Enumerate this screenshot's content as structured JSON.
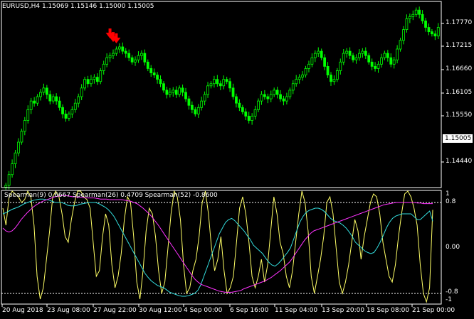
{
  "symbol_header": "EURUSD,H4  1.15069 1.15146 1.15000 1.15005",
  "indicator_header": "Spearman(9) 0.6667  Spearman(26) 0.4709  Spearman(52) -0.8600",
  "current_price": "1.15005",
  "price_axis": [
    "1.17770",
    "1.17215",
    "1.16660",
    "1.16105",
    "1.15550",
    "1.14440"
  ],
  "indicator_axis": [
    "1",
    "0.8",
    "0.00",
    "-0.8",
    "-1"
  ],
  "time_axis": [
    "20 Aug 2018",
    "23 Aug 08:00",
    "27 Aug 22:00",
    "30 Aug 12:00",
    "4 Sep 00:00",
    "6 Sep 16:00",
    "11 Sep 04:00",
    "13 Sep 20:00",
    "18 Sep 08:00",
    "21 Sep 00:00"
  ],
  "colors": {
    "background": "#000000",
    "candles": "#00ff00",
    "arrows": "#ff0000",
    "spearman9": "#ffff66",
    "spearman26": "#33dddd",
    "spearman52": "#ff33ff"
  },
  "chart_data": {
    "type": "candlestick",
    "price_ylim": [
      1.139,
      1.182
    ],
    "price_closes": [
      1.1395,
      1.142,
      1.1445,
      1.147,
      1.1495,
      1.152,
      1.1545,
      1.157,
      1.159,
      1.1585,
      1.16,
      1.161,
      1.162,
      1.1605,
      1.159,
      1.16,
      1.159,
      1.1575,
      1.156,
      1.155,
      1.156,
      1.157,
      1.1585,
      1.16,
      1.162,
      1.164,
      1.163,
      1.164,
      1.1645,
      1.1635,
      1.166,
      1.1675,
      1.169,
      1.1695,
      1.17,
      1.171,
      1.1715,
      1.1705,
      1.17,
      1.169,
      1.168,
      1.1685,
      1.1695,
      1.17,
      1.168,
      1.1665,
      1.1655,
      1.165,
      1.164,
      1.163,
      1.1615,
      1.1605,
      1.161,
      1.1615,
      1.1605,
      1.162,
      1.161,
      1.1595,
      1.158,
      1.157,
      1.156,
      1.1575,
      1.159,
      1.1605,
      1.1625,
      1.163,
      1.164,
      1.163,
      1.1625,
      1.164,
      1.1635,
      1.162,
      1.16,
      1.1585,
      1.1575,
      1.1565,
      1.1555,
      1.1545,
      1.1555,
      1.157,
      1.159,
      1.1605,
      1.16,
      1.1595,
      1.1605,
      1.1615,
      1.1605,
      1.1595,
      1.159,
      1.16,
      1.1615,
      1.163,
      1.164,
      1.1645,
      1.165,
      1.1665,
      1.1675,
      1.169,
      1.17,
      1.1705,
      1.169,
      1.167,
      1.165,
      1.1635,
      1.164,
      1.166,
      1.168,
      1.17,
      1.1705,
      1.1695,
      1.1685,
      1.169,
      1.17,
      1.1705,
      1.1695,
      1.168,
      1.167,
      1.1665,
      1.1675,
      1.169,
      1.17,
      1.169,
      1.1675,
      1.1685,
      1.171,
      1.173,
      1.1755,
      1.178,
      1.1785,
      1.179,
      1.18,
      1.179,
      1.1775,
      1.176,
      1.175,
      1.1745,
      1.174,
      1.176
    ],
    "arrow_index_range": [
      33,
      35
    ],
    "series": [
      {
        "name": "Spearman(9)",
        "values": [
          0.7,
          0.4,
          0.9,
          1.0,
          0.95,
          0.9,
          0.8,
          0.85,
          1.0,
          0.9,
          0.4,
          -0.5,
          -0.9,
          -0.7,
          -0.2,
          0.3,
          0.9,
          1.0,
          0.9,
          0.6,
          0.2,
          0.1,
          0.5,
          0.8,
          1.0,
          1.0,
          0.9,
          0.85,
          0.7,
          0.1,
          -0.5,
          -0.4,
          0.2,
          0.6,
          0.4,
          -0.3,
          -0.7,
          -0.5,
          -0.1,
          0.5,
          0.9,
          0.8,
          0.2,
          -0.6,
          -0.9,
          -0.4,
          0.3,
          0.7,
          0.6,
          0.2,
          -0.4,
          -0.8,
          -0.6,
          0.0,
          0.6,
          1.0,
          0.9,
          0.5,
          -0.3,
          -0.8,
          -0.7,
          -0.4,
          -0.2,
          0.2,
          0.8,
          1.0,
          0.6,
          0.0,
          -0.4,
          -0.2,
          0.2,
          -0.4,
          -0.8,
          -0.7,
          -0.5,
          0.1,
          0.7,
          0.9,
          0.6,
          0.1,
          -0.5,
          -0.7,
          -0.5,
          -0.2,
          -0.6,
          -0.3,
          0.3,
          0.9,
          0.6,
          0.1,
          -0.1,
          -0.5,
          -0.7,
          -0.4,
          0.1,
          0.6,
          1.0,
          0.8,
          0.3,
          -0.5,
          -0.8,
          -0.5,
          -0.2,
          0.2,
          0.8,
          0.9,
          0.6,
          0.0,
          -0.6,
          -0.8,
          -0.6,
          -0.3,
          0.1,
          0.5,
          0.3,
          -0.2,
          0.2,
          0.5,
          0.8,
          0.95,
          0.9,
          0.6,
          0.1,
          -0.2,
          -0.5,
          -0.6,
          -0.3,
          0.2,
          0.6,
          0.95,
          1.0,
          0.9,
          0.7,
          0.4,
          -0.3,
          -0.8,
          -0.95,
          -0.7,
          0.67
        ]
      },
      {
        "name": "Spearman(26)",
        "values": [
          0.6,
          0.62,
          0.65,
          0.68,
          0.7,
          0.72,
          0.75,
          0.78,
          0.8,
          0.82,
          0.84,
          0.85,
          0.86,
          0.86,
          0.85,
          0.84,
          0.82,
          0.8,
          0.8,
          0.8,
          0.78,
          0.75,
          0.74,
          0.74,
          0.75,
          0.77,
          0.78,
          0.79,
          0.8,
          0.8,
          0.8,
          0.78,
          0.75,
          0.72,
          0.68,
          0.62,
          0.55,
          0.45,
          0.35,
          0.25,
          0.15,
          0.05,
          -0.05,
          -0.15,
          -0.25,
          -0.35,
          -0.45,
          -0.52,
          -0.58,
          -0.62,
          -0.66,
          -0.68,
          -0.7,
          -0.74,
          -0.78,
          -0.8,
          -0.82,
          -0.84,
          -0.85,
          -0.85,
          -0.84,
          -0.82,
          -0.8,
          -0.75,
          -0.65,
          -0.5,
          -0.35,
          -0.2,
          -0.05,
          0.1,
          0.25,
          0.35,
          0.45,
          0.5,
          0.52,
          0.48,
          0.42,
          0.36,
          0.3,
          0.22,
          0.15,
          0.05,
          0.0,
          -0.05,
          -0.1,
          -0.18,
          -0.25,
          -0.3,
          -0.32,
          -0.28,
          -0.22,
          -0.15,
          -0.08,
          0.0,
          0.15,
          0.3,
          0.45,
          0.55,
          0.62,
          0.66,
          0.68,
          0.7,
          0.7,
          0.68,
          0.64,
          0.58,
          0.52,
          0.48,
          0.46,
          0.44,
          0.4,
          0.35,
          0.28,
          0.2,
          0.1,
          0.05,
          0.0,
          -0.05,
          -0.08,
          -0.1,
          -0.08,
          0.0,
          0.1,
          0.22,
          0.35,
          0.45,
          0.52,
          0.56,
          0.58,
          0.6,
          0.6,
          0.6,
          0.6,
          0.55,
          0.5,
          0.5,
          0.55,
          0.6,
          0.65,
          0.47
        ]
      },
      {
        "name": "Spearman(52)",
        "values": [
          0.35,
          0.3,
          0.28,
          0.3,
          0.35,
          0.42,
          0.5,
          0.56,
          0.62,
          0.67,
          0.72,
          0.76,
          0.79,
          0.82,
          0.84,
          0.86,
          0.88,
          0.9,
          0.91,
          0.92,
          0.92,
          0.92,
          0.91,
          0.9,
          0.9,
          0.89,
          0.89,
          0.88,
          0.88,
          0.88,
          0.88,
          0.87,
          0.86,
          0.86,
          0.86,
          0.85,
          0.85,
          0.85,
          0.85,
          0.85,
          0.84,
          0.83,
          0.82,
          0.8,
          0.78,
          0.74,
          0.7,
          0.65,
          0.6,
          0.54,
          0.47,
          0.4,
          0.32,
          0.24,
          0.16,
          0.08,
          0.0,
          -0.08,
          -0.16,
          -0.24,
          -0.32,
          -0.4,
          -0.48,
          -0.55,
          -0.6,
          -0.64,
          -0.66,
          -0.68,
          -0.7,
          -0.72,
          -0.74,
          -0.76,
          -0.77,
          -0.78,
          -0.78,
          -0.78,
          -0.77,
          -0.76,
          -0.75,
          -0.72,
          -0.7,
          -0.68,
          -0.66,
          -0.64,
          -0.62,
          -0.6,
          -0.58,
          -0.55,
          -0.52,
          -0.48,
          -0.44,
          -0.4,
          -0.35,
          -0.3,
          -0.25,
          -0.18,
          -0.1,
          -0.02,
          0.06,
          0.14,
          0.2,
          0.26,
          0.3,
          0.32,
          0.34,
          0.36,
          0.38,
          0.4,
          0.42,
          0.44,
          0.46,
          0.48,
          0.5,
          0.52,
          0.54,
          0.56,
          0.58,
          0.6,
          0.62,
          0.64,
          0.66,
          0.68,
          0.7,
          0.72,
          0.74,
          0.76,
          0.77,
          0.78,
          0.79,
          0.8,
          0.8,
          0.8,
          0.8,
          0.8,
          0.8,
          0.8,
          0.79,
          0.79,
          0.78,
          0.78,
          0.78,
          0.78
        ]
      }
    ]
  }
}
